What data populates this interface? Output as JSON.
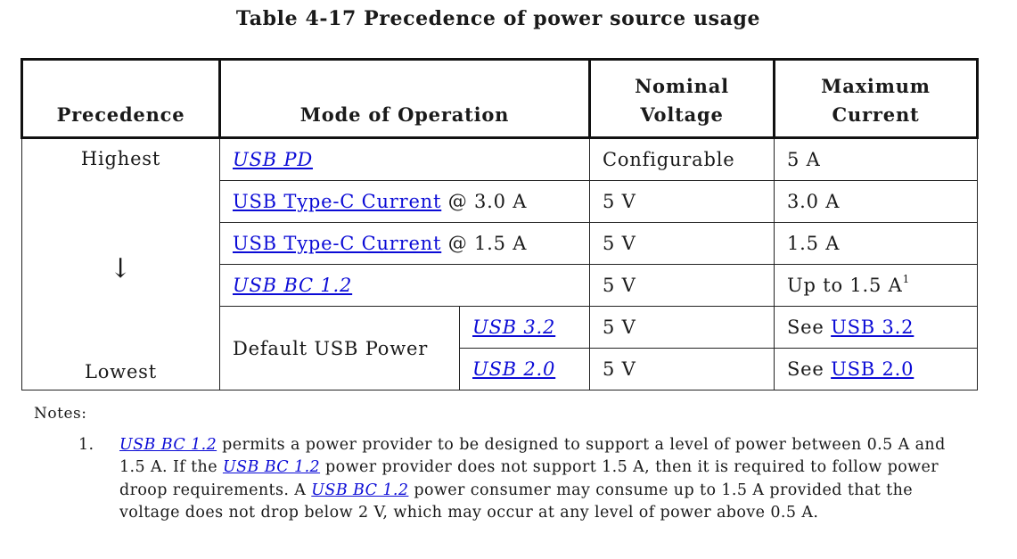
{
  "title": "Table 4-17  Precedence of power source usage",
  "headers": {
    "precedence": "Precedence",
    "mode": "Mode of Operation",
    "voltage_l1": "Nominal",
    "voltage_l2": "Voltage",
    "current_l1": "Maximum",
    "current_l2": "Current"
  },
  "precedence": {
    "highest": "Highest",
    "arrow": "↓",
    "lowest": "Lowest"
  },
  "rows": [
    {
      "mode_link": "USB PD",
      "mode_suffix": "",
      "voltage": "Configurable",
      "current": "5 A"
    },
    {
      "mode_link": "USB Type-C Current",
      "mode_suffix": " @ 3.0 A",
      "voltage": "5 V",
      "current": "3.0 A"
    },
    {
      "mode_link": "USB Type-C Current",
      "mode_suffix": " @ 1.5 A",
      "voltage": "5 V",
      "current": "1.5 A"
    },
    {
      "mode_link": "USB BC 1.2",
      "mode_suffix": "",
      "voltage": "5 V",
      "current": "Up to 1.5 A",
      "current_sup": "1"
    },
    {
      "group": "Default USB Power",
      "sub_link": "USB 3.2",
      "voltage": "5 V",
      "current_prefix": "See ",
      "current_link": "USB 3.2"
    },
    {
      "group": "Default USB Power",
      "sub_link": "USB 2.0",
      "voltage": "5 V",
      "current_prefix": "See ",
      "current_link": "USB 2.0"
    }
  ],
  "notes": {
    "label": "Notes:",
    "items": [
      {
        "num": "1.",
        "link1": "USB BC 1.2",
        "text1": " permits a power provider to be designed to support a level of power between 0.5 A and 1.5 A.  If the ",
        "link2": "USB BC 1.2",
        "text2": " power provider does not support 1.5 A, then it is required to follow power droop requirements.  A ",
        "link3": "USB BC 1.2",
        "text3": " power consumer may consume up to 1.5 A provided that the voltage does not drop below 2 V, which may occur at any level of power above 0.5 A."
      }
    ]
  },
  "colors": {
    "link": "#0b0bd6",
    "text": "#1a1a1a",
    "border": "#111111"
  }
}
